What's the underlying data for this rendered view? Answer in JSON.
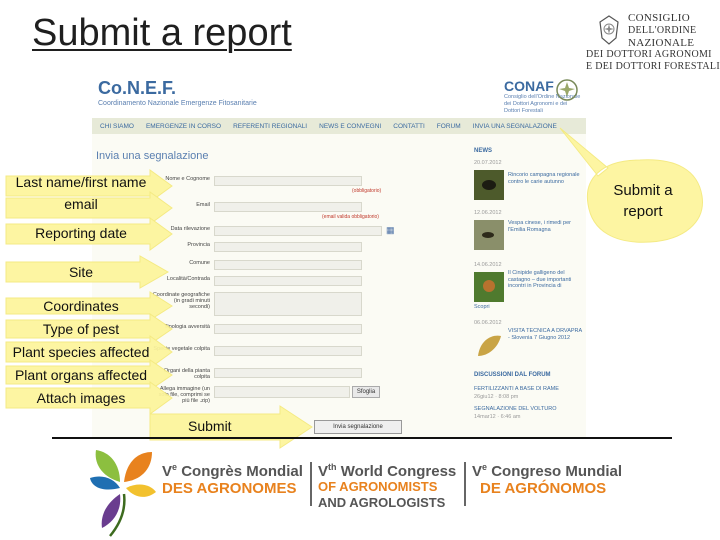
{
  "slide": {
    "title": "Submit a report",
    "callout": "Submit a report",
    "annotations": {
      "name": "Last name/first name",
      "email": "email",
      "date": "Reporting date",
      "site": "Site",
      "coords": "Coordinates",
      "pest": "Type of pest",
      "species": "Plant species affected",
      "organs": "Plant organs affected",
      "attach": "Attach images",
      "submit": "Submit"
    }
  },
  "council": {
    "lines": [
      "CONSIGLIO",
      "DELL'ORDINE",
      "NAZIONALE",
      "DEI DOTTORI AGRONOMI",
      "E DEI DOTTORI FORESTALI"
    ]
  },
  "site": {
    "logo": "Co.N.E.F.",
    "logo_sub": "Coordinamento Nazionale Emergenze Fitosanitarie",
    "conaf": "CONAF",
    "conaf_sub": "Consiglio dell'Ordine Nazionale dei Dottori Agronomi e dei Dottori Forestali",
    "nav": [
      "CHI SIAMO",
      "EMERGENZE IN CORSO",
      "REFERENTI REGIONALI",
      "NEWS E CONVEGNI",
      "CONTATTI",
      "FORUM",
      "INVIA UNA SEGNALAZIONE"
    ],
    "heading": "Invia una segnalazione",
    "form": {
      "labels": [
        "Nome e Cognome",
        "Email",
        "Data rilevazione",
        "Provincia",
        "Comune",
        "Località/Contrada",
        "Coordinate geografiche (in gradi minuti secondi)",
        "Tipologia avversità",
        "Specie vegetale colpita",
        "Organi della pianta colpita",
        "Allega immagine (un solo file, comprimi se più file .zip)"
      ],
      "required_note": "(obbligatorio)",
      "email_note": "(email valida obbligatorio)",
      "browse": "Sfoglia",
      "submit": "Invia segnalazione"
    },
    "news": {
      "heading": "NEWS",
      "items": [
        {
          "date": "20.07.2012",
          "text": "Rincorio campagna regionale contro le carie autunno"
        },
        {
          "date": "12.06.2012",
          "text": "Vespa cinese, i rimedi per l'Emilia Romagna"
        },
        {
          "date": "14.06.2012",
          "text": "Il Cinipide galligeno del castagno – due importanti incontri in Provincia di"
        },
        {
          "date": "06.06.2012",
          "text": "VISITA TECNICA A DRVAPRA - Slovenia 7 Giugno 2012"
        }
      ],
      "more": "Scopri",
      "forum_heading": "DISCUSSIONI DAL FORUM",
      "forum": [
        "FERTILIZZANTI A BASE DI RAME",
        "26giu12 · 8:08 pm",
        "SEGNALAZIONE DEL VOLTURO",
        "14mar12 · 6:46 am"
      ]
    }
  },
  "congress": {
    "fr_top": "Congrès Mondial",
    "fr_bottom": "DES AGRONOMES",
    "en_top": "World Congress",
    "en_mid": "OF AGRONOMISTS",
    "en_bottom": "AND AGROLOGISTS",
    "es_top": "Congreso Mundial",
    "es_bottom": "DE AGRÓNOMOS",
    "ordinal_fr": "V",
    "ordinal_fr_sup": "e",
    "ordinal_en": "V",
    "ordinal_en_sup": "th",
    "ordinal_es": "V",
    "ordinal_es_sup": "e"
  },
  "colors": {
    "accent_yellow": "#fdf59b",
    "site_blue": "#3b6aa0",
    "congress_orange": "#e8821e",
    "congress_gray": "#555555"
  }
}
